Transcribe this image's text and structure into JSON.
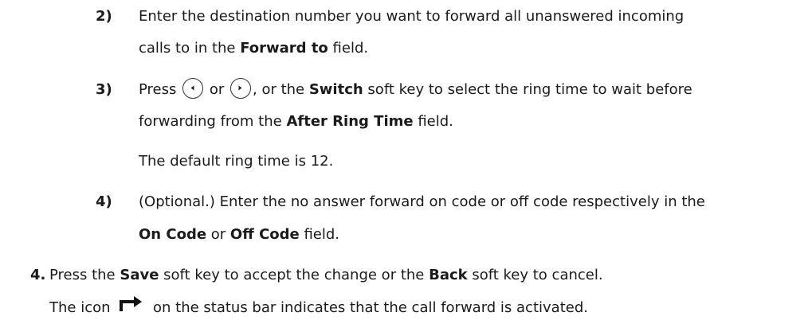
{
  "step2": {
    "number": "2)",
    "line1": "Enter the destination number you want to forward all unanswered incoming",
    "line2_pre": "calls to in the ",
    "line2_bold": "Forward to",
    "line2_post": " field."
  },
  "step3": {
    "number": "3)",
    "press": "Press",
    "or": "or",
    "mid": ", or the ",
    "bold1": "Switch",
    "line1_post": " soft key to select the ring time to wait before",
    "line2_pre": "forwarding from the ",
    "bold2": "After Ring Time",
    "line2_post": " field.",
    "note": "The default ring time is 12.",
    "left_icon": "left-arrow-key-icon",
    "right_icon": "right-arrow-key-icon"
  },
  "step4sub": {
    "number": "4)",
    "line1": "(Optional.) Enter the no answer forward on code or off code respectively in the",
    "bold1": "On Code",
    "or": " or ",
    "bold2": "Off Code",
    "line2_post": " field."
  },
  "step4": {
    "number": "4.",
    "pre": "Press the ",
    "bold1": "Save",
    "mid": " soft key to accept the change or the ",
    "bold2": "Back",
    "post": " soft key to cancel.",
    "icon_pre": "The icon",
    "icon_post": "on the status bar indicates that the call forward is activated.",
    "icon_name": "call-forward-icon"
  }
}
